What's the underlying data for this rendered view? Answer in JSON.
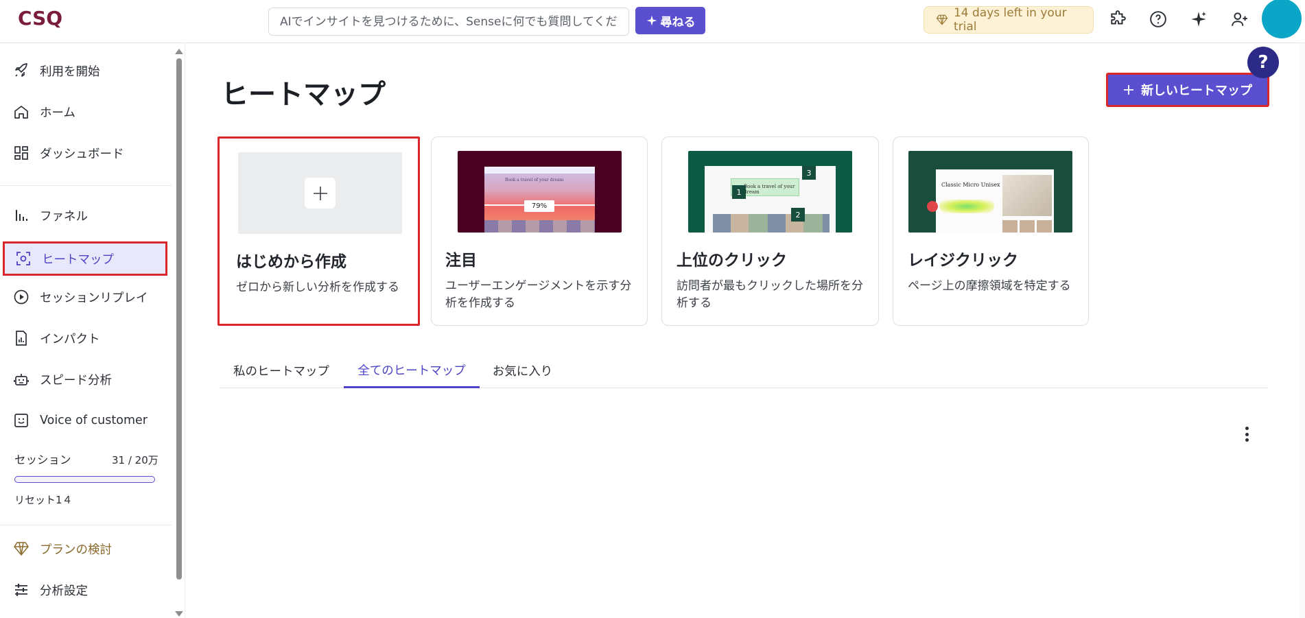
{
  "brand": {
    "logo_text": "CSQ"
  },
  "header": {
    "search_placeholder": "AIでインサイトを見つけるために、Senseに何でも質問してください",
    "ask_label": "尋ねる",
    "trial_text": "14 days left in your trial",
    "icons": [
      "puzzle-icon",
      "help-circle-icon",
      "sparkle-icon",
      "add-user-icon"
    ]
  },
  "sidebar": {
    "items": [
      {
        "label": "利用を開始",
        "icon": "rocket-icon"
      },
      {
        "label": "ホーム",
        "icon": "home-icon"
      },
      {
        "label": "ダッシュボード",
        "icon": "dashboard-icon"
      },
      {
        "label": "ファネル",
        "icon": "funnel-icon"
      },
      {
        "label": "ヒートマップ",
        "icon": "heatmap-icon",
        "active": true
      },
      {
        "label": "セッションリプレイ",
        "icon": "play-circle-icon"
      },
      {
        "label": "インパクト",
        "icon": "impact-report-icon"
      },
      {
        "label": "スピード分析",
        "icon": "speed-robot-icon"
      },
      {
        "label": "Voice of customer",
        "icon": "feedback-face-icon"
      }
    ],
    "sessions": {
      "label": "セッション",
      "count": "31 / 20万",
      "progress": 0.0002,
      "reset": "リセット1４"
    },
    "plan_label": "プランの検討",
    "settings_label": "分析設定"
  },
  "main": {
    "title": "ヒートマップ",
    "new_button": "新しいヒートマップ",
    "help_label": "?",
    "cards": [
      {
        "title": "はじめから作成",
        "desc": "ゼロから新しい分析を作成する"
      },
      {
        "title": "注目",
        "desc": "ユーザーエンゲージメントを示す分析を作成する"
      },
      {
        "title": "上位のクリック",
        "desc": "訪問者が最もクリックした場所を分析する"
      },
      {
        "title": "レイジクリック",
        "desc": "ページ上の摩擦領域を特定する"
      }
    ],
    "thumbs": {
      "attention": {
        "headline": "Book a travel of your dream",
        "percent": "79%"
      },
      "clicks": {
        "headline": "Book a travel of your dream",
        "rank1": "1",
        "rank2": "2",
        "rank3": "3"
      },
      "rage": {
        "headline": "Classic Micro Unisex"
      }
    },
    "tabs": [
      {
        "label": "私のヒートマップ"
      },
      {
        "label": "全てのヒートマップ",
        "active": true
      },
      {
        "label": "お気に入り"
      }
    ]
  },
  "colors": {
    "accent": "#5a4fcf",
    "highlight": "#d9262b",
    "avatar": "#0aa5c7",
    "trial": "#fdf1d6"
  }
}
